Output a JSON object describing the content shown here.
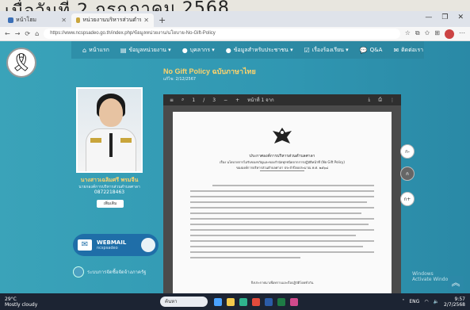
{
  "caption": {
    "text": "เมื่อวันที่ 2 กรกฎาคม 2568"
  },
  "browser": {
    "tabs": [
      {
        "label": "หน้าโฮม",
        "active": false
      },
      {
        "label": "หน่วยงานบริหารส่วนตำบลศาลา",
        "active": true
      }
    ],
    "url": "https://www.ncspsadeo.go.th/index.php/ข้อมูลหน่วยงาน/นโยบาย-No-Gift-Policy",
    "window_controls": [
      "—",
      "❐",
      "✕"
    ]
  },
  "site": {
    "nav": [
      {
        "icon": "home-icon",
        "label": "หน้าแรก"
      },
      {
        "icon": "folder-icon",
        "label": "ข้อมูลหน่วยงาน ▾"
      },
      {
        "icon": "person-icon",
        "label": "บุคลากร ▾"
      },
      {
        "icon": "person-icon",
        "label": "ข้อมูลสำหรับประชาชน ▾"
      },
      {
        "icon": "check-icon",
        "label": "เรื่องร้องเรียน ▾"
      },
      {
        "icon": "chat-icon",
        "label": "Q&A"
      },
      {
        "icon": "mail-icon",
        "label": "ติดต่อเรา"
      }
    ],
    "profile": {
      "name": "นางสาวเฉลิมศรี พรมจีน",
      "position": "นายกองค์การบริหารส่วนตำบลศาลา",
      "phone": "0872218463",
      "more_label": "เพิ่มเติม"
    },
    "webmail": {
      "title": "WEBMAIL",
      "subtitle": "ncspsadeo"
    },
    "procurement_label": "ระบบการจัดซื้อจัดจ้างภาครัฐ",
    "content": {
      "title": "No Gift Policy ฉบับภาษาไทย",
      "date": "แก้ไข: 2/12/2567"
    },
    "pdf": {
      "toolbar": [
        "≡",
        "⌕",
        "1",
        "/",
        "3",
        "−",
        "+",
        "หน้าที่ 1 จาก",
        "⤓",
        "⎙",
        "⋮"
      ],
      "heading1": "ประกาศองค์การบริหารส่วนตำบลศาลา",
      "heading2": "เรื่อง นโยบายการไม่รับของขวัญและของกำนัลทุกชนิดจากการปฏิบัติหน้าที่ (No Gift Policy)",
      "heading3": "ขององค์การบริหารส่วนตำบลศาลา ประจำปีงบประมาณ พ.ศ. ๒๕๖๘",
      "footer": "จึงประกาศมาเพื่อทราบและถือปฏิบัติโดยทั่วกัน"
    },
    "side_buttons": [
      "ก-",
      "ก",
      "ก+"
    ],
    "activate_windows": {
      "line1": "Windows",
      "line2": "Activate Windows"
    }
  },
  "taskbar": {
    "weather": {
      "temp": "29°C",
      "desc": "Mostly cloudy"
    },
    "search": "ค้นหา",
    "clock": {
      "time": "9:57",
      "date": "2/7/2568"
    },
    "lang": "ENG"
  }
}
